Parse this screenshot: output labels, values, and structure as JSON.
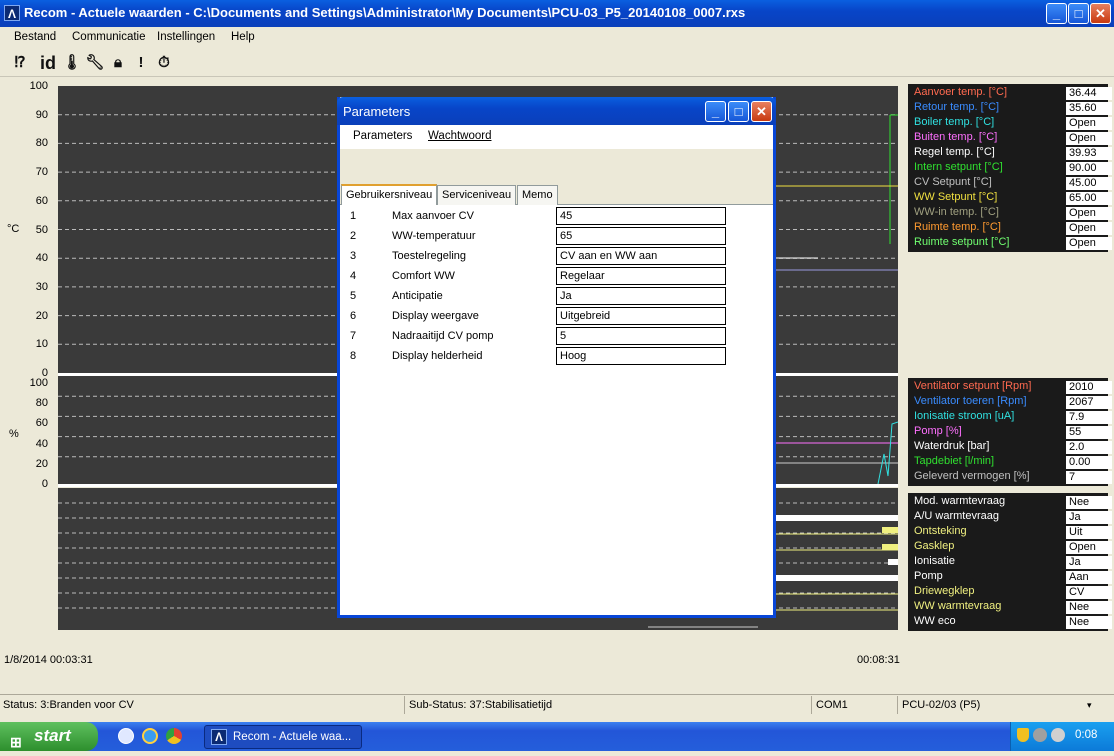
{
  "window": {
    "title": "Recom - Actuele waarden - C:\\Documents and Settings\\Administrator\\My Documents\\PCU-03_P5_20140108_0007.rxs"
  },
  "menu": {
    "items": [
      "Bestand",
      "Communicatie",
      "Instellingen",
      "Help"
    ]
  },
  "toolbar": {
    "icons": [
      "help-icon",
      "id-icon",
      "thermometer-icon",
      "wrench-icon",
      "lock-icon",
      "alert-icon",
      "stopwatch-icon"
    ],
    "id_label": "id"
  },
  "axis_temp": {
    "ticks": [
      "100",
      "90",
      "80",
      "70",
      "60",
      "50",
      "40",
      "30",
      "20",
      "10",
      "0"
    ],
    "unit": "°C"
  },
  "axis_pct": {
    "ticks": [
      "100",
      "80",
      "60",
      "40",
      "20",
      "0"
    ],
    "unit": "%"
  },
  "time": {
    "start": "1/8/2014 00:03:31",
    "end": "00:08:31"
  },
  "legend_temp": [
    {
      "label": "Aanvoer temp. [°C]",
      "value": "36.44",
      "color": "#ff6a50"
    },
    {
      "label": "Retour temp. [°C]",
      "value": "35.60",
      "color": "#3a8cff"
    },
    {
      "label": "Boiler temp. [°C]",
      "value": "Open",
      "color": "#30e0e0"
    },
    {
      "label": "Buiten temp. [°C]",
      "value": "Open",
      "color": "#ff70ff"
    },
    {
      "label": "Regel temp. [°C]",
      "value": "39.93",
      "color": "#ffffff"
    },
    {
      "label": "Intern setpunt [°C]",
      "value": "90.00",
      "color": "#30e030"
    },
    {
      "label": "CV Setpunt [°C]",
      "value": "45.00",
      "color": "#c0c0c0"
    },
    {
      "label": "WW Setpunt [°C]",
      "value": "65.00",
      "color": "#f0e040"
    },
    {
      "label": "WW-in temp. [°C]",
      "value": "Open",
      "color": "#a0a080"
    },
    {
      "label": "Ruimte temp. [°C]",
      "value": "Open",
      "color": "#ff9a30"
    },
    {
      "label": "Ruimte setpunt [°C]",
      "value": "Open",
      "color": "#70ff70"
    }
  ],
  "legend_pct": [
    {
      "label": "Ventilator setpunt [Rpm]",
      "value": "2010",
      "color": "#ff6a50"
    },
    {
      "label": "Ventilator toeren [Rpm]",
      "value": "2067",
      "color": "#3a8cff"
    },
    {
      "label": "Ionisatie stroom [uA]",
      "value": "7.9",
      "color": "#30e0e0"
    },
    {
      "label": "Pomp [%]",
      "value": "55",
      "color": "#ff70ff"
    },
    {
      "label": "Waterdruk [bar]",
      "value": "2.0",
      "color": "#ffffff"
    },
    {
      "label": "Tapdebiet [l/min]",
      "value": "0.00",
      "color": "#30e030"
    },
    {
      "label": "Geleverd vermogen [%]",
      "value": "7",
      "color": "#c0c0c0"
    }
  ],
  "legend_status": [
    {
      "label": "Mod. warmtevraag",
      "value": "Nee",
      "color": "#ffffff"
    },
    {
      "label": "A/U warmtevraag",
      "value": "Ja",
      "color": "#ffffff"
    },
    {
      "label": "Ontsteking",
      "value": "Uit",
      "color": "#f0f080"
    },
    {
      "label": "Gasklep",
      "value": "Open",
      "color": "#f0f080"
    },
    {
      "label": "Ionisatie",
      "value": "Ja",
      "color": "#ffffff"
    },
    {
      "label": "Pomp",
      "value": "Aan",
      "color": "#ffffff"
    },
    {
      "label": "Driewegklep",
      "value": "CV",
      "color": "#f0f080"
    },
    {
      "label": "WW warmtevraag",
      "value": "Nee",
      "color": "#f0f080"
    },
    {
      "label": "WW eco",
      "value": "Nee",
      "color": "#ffffff"
    }
  ],
  "status": {
    "status": "Status: 3:Branden voor CV",
    "substatus": "Sub-Status: 37:Stabilisatietijd",
    "port": "COM1",
    "device": "PCU-02/03 (P5)"
  },
  "dialog": {
    "title": "Parameters",
    "menu": [
      "Parameters",
      "Wachtwoord"
    ],
    "tabs": [
      "Gebruikersniveau",
      "Serviceniveau",
      "Memo"
    ],
    "rows": [
      {
        "n": "1",
        "label": "Max aanvoer CV",
        "value": "45"
      },
      {
        "n": "2",
        "label": "WW-temperatuur",
        "value": "65"
      },
      {
        "n": "3",
        "label": "Toestelregeling",
        "value": "CV aan en WW aan"
      },
      {
        "n": "4",
        "label": "Comfort WW",
        "value": "Regelaar"
      },
      {
        "n": "5",
        "label": "Anticipatie",
        "value": "Ja"
      },
      {
        "n": "6",
        "label": "Display weergave",
        "value": "Uitgebreid"
      },
      {
        "n": "7",
        "label": "Nadraaitijd CV pomp",
        "value": "5"
      },
      {
        "n": "8",
        "label": "Display helderheid",
        "value": "Hoog"
      }
    ]
  },
  "taskbar": {
    "start": "start",
    "task": "Recom - Actuele waa...",
    "clock": "0:08"
  }
}
